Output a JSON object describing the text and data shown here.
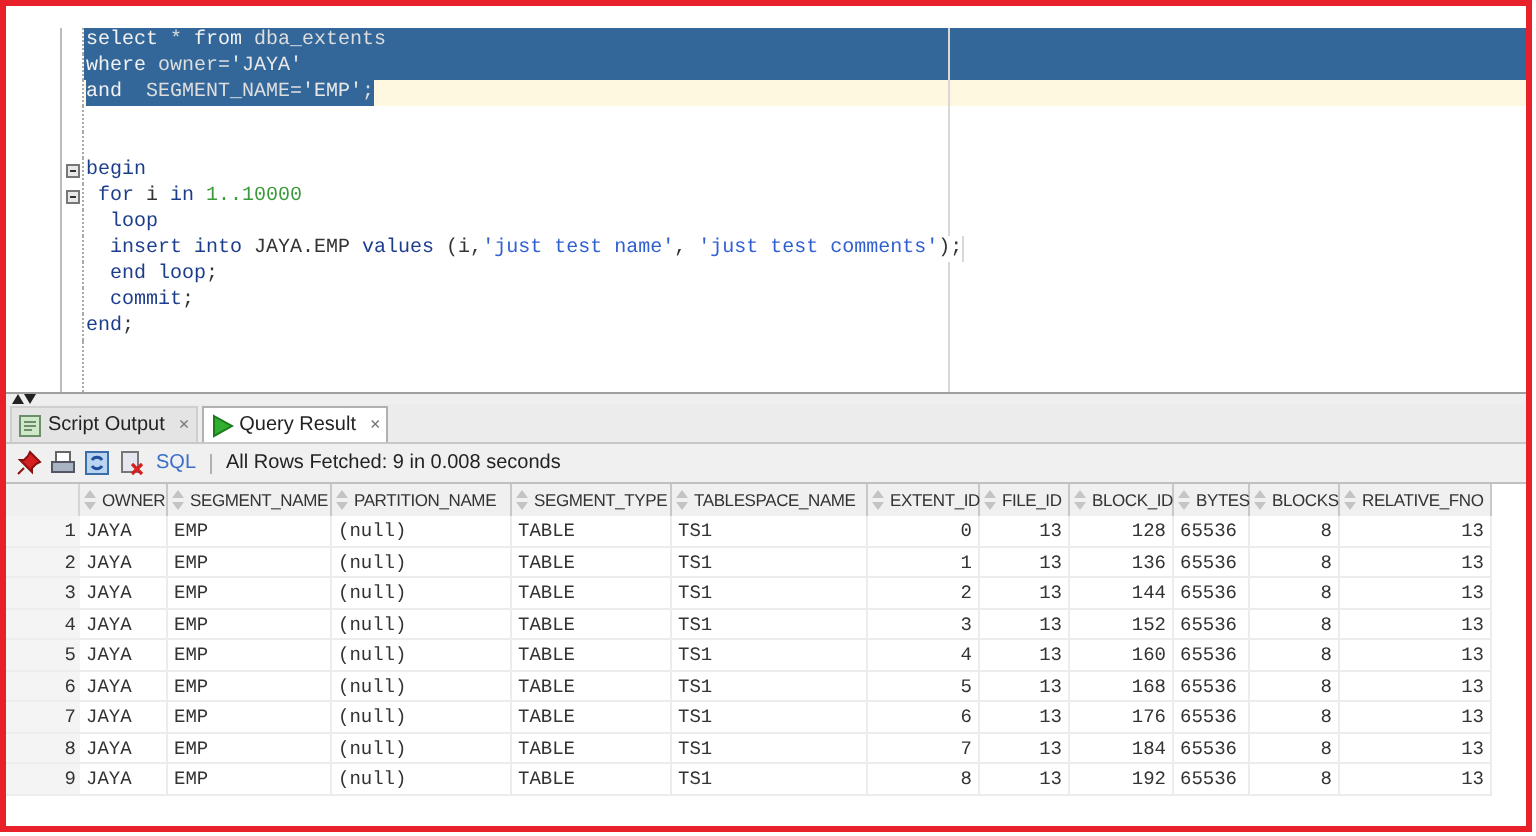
{
  "editor": {
    "lines": [
      {
        "kind": "code",
        "selected": true,
        "current": false,
        "foldable": false,
        "tokens": [
          {
            "kind": "keyword",
            "text": "select"
          },
          {
            "kind": "plain",
            "text": " * "
          },
          {
            "kind": "keyword",
            "text": "from"
          },
          {
            "kind": "plain",
            "text": " dba_extents"
          }
        ]
      },
      {
        "kind": "code",
        "selected": true,
        "current": false,
        "foldable": false,
        "tokens": [
          {
            "kind": "keyword",
            "text": "where"
          },
          {
            "kind": "plain",
            "text": " owner="
          },
          {
            "kind": "string",
            "text": "'JAYA'"
          }
        ]
      },
      {
        "kind": "code",
        "selected": true,
        "current": true,
        "foldable": false,
        "tokens": [
          {
            "kind": "keyword",
            "text": "and"
          },
          {
            "kind": "plain",
            "text": "  SEGMENT_NAME="
          },
          {
            "kind": "string",
            "text": "'EMP'"
          },
          {
            "kind": "plain",
            "text": ";"
          }
        ]
      },
      {
        "kind": "blank"
      },
      {
        "kind": "blank"
      },
      {
        "kind": "code",
        "selected": false,
        "current": false,
        "foldable": true,
        "tokens": [
          {
            "kind": "keyword",
            "text": "begin"
          }
        ]
      },
      {
        "kind": "code",
        "selected": false,
        "current": false,
        "foldable": true,
        "tokens": [
          {
            "kind": "keyword",
            "text": " for"
          },
          {
            "kind": "plain",
            "text": " i "
          },
          {
            "kind": "keyword",
            "text": "in"
          },
          {
            "kind": "number",
            "text": " 1..10000"
          }
        ]
      },
      {
        "kind": "code",
        "selected": false,
        "current": false,
        "foldable": false,
        "tokens": [
          {
            "kind": "keyword",
            "text": "  loop"
          }
        ]
      },
      {
        "kind": "code",
        "selected": false,
        "current": false,
        "foldable": false,
        "tokens": [
          {
            "kind": "keyword",
            "text": "  insert into"
          },
          {
            "kind": "plain",
            "text": " JAYA.EMP "
          },
          {
            "kind": "keyword",
            "text": "values"
          },
          {
            "kind": "plain",
            "text": " (i,"
          },
          {
            "kind": "string",
            "text": "'just test name'"
          },
          {
            "kind": "plain",
            "text": ", "
          },
          {
            "kind": "string",
            "text": "'just test comments'"
          },
          {
            "kind": "plain",
            "text": ");"
          }
        ]
      },
      {
        "kind": "code",
        "selected": false,
        "current": false,
        "foldable": false,
        "tokens": [
          {
            "kind": "keyword",
            "text": "  end loop"
          },
          {
            "kind": "plain",
            "text": ";"
          }
        ]
      },
      {
        "kind": "code",
        "selected": false,
        "current": false,
        "foldable": false,
        "tokens": [
          {
            "kind": "keyword",
            "text": "  commit"
          },
          {
            "kind": "plain",
            "text": ";"
          }
        ]
      },
      {
        "kind": "code",
        "selected": false,
        "current": false,
        "foldable": false,
        "tokens": [
          {
            "kind": "keyword",
            "text": "end"
          },
          {
            "kind": "plain",
            "text": ";"
          }
        ]
      }
    ]
  },
  "tabs": [
    {
      "label": "Script Output",
      "selected": false,
      "close": "×"
    },
    {
      "label": "Query Result",
      "selected": true,
      "close": "×"
    }
  ],
  "toolbar": {
    "sql_link": "SQL",
    "status": "All Rows Fetched: 9 in 0.008 seconds"
  },
  "table": {
    "columns": [
      "OWNER",
      "SEGMENT_NAME",
      "PARTITION_NAME",
      "SEGMENT_TYPE",
      "TABLESPACE_NAME",
      "EXTENT_ID",
      "FILE_ID",
      "BLOCK_ID",
      "BYTES",
      "BLOCKS",
      "RELATIVE_FNO"
    ],
    "rows": [
      {
        "number": "1",
        "cells": [
          "JAYA",
          "EMP",
          "(null)",
          "TABLE",
          "TS1",
          "0",
          "13",
          "128",
          "65536",
          "8",
          "13"
        ]
      },
      {
        "number": "2",
        "cells": [
          "JAYA",
          "EMP",
          "(null)",
          "TABLE",
          "TS1",
          "1",
          "13",
          "136",
          "65536",
          "8",
          "13"
        ]
      },
      {
        "number": "3",
        "cells": [
          "JAYA",
          "EMP",
          "(null)",
          "TABLE",
          "TS1",
          "2",
          "13",
          "144",
          "65536",
          "8",
          "13"
        ]
      },
      {
        "number": "4",
        "cells": [
          "JAYA",
          "EMP",
          "(null)",
          "TABLE",
          "TS1",
          "3",
          "13",
          "152",
          "65536",
          "8",
          "13"
        ]
      },
      {
        "number": "5",
        "cells": [
          "JAYA",
          "EMP",
          "(null)",
          "TABLE",
          "TS1",
          "4",
          "13",
          "160",
          "65536",
          "8",
          "13"
        ]
      },
      {
        "number": "6",
        "cells": [
          "JAYA",
          "EMP",
          "(null)",
          "TABLE",
          "TS1",
          "5",
          "13",
          "168",
          "65536",
          "8",
          "13"
        ]
      },
      {
        "number": "7",
        "cells": [
          "JAYA",
          "EMP",
          "(null)",
          "TABLE",
          "TS1",
          "6",
          "13",
          "176",
          "65536",
          "8",
          "13"
        ]
      },
      {
        "number": "8",
        "cells": [
          "JAYA",
          "EMP",
          "(null)",
          "TABLE",
          "TS1",
          "7",
          "13",
          "184",
          "65536",
          "8",
          "13"
        ]
      },
      {
        "number": "9",
        "cells": [
          "JAYA",
          "EMP",
          "(null)",
          "TABLE",
          "TS1",
          "8",
          "13",
          "192",
          "65536",
          "8",
          "13"
        ]
      }
    ]
  }
}
